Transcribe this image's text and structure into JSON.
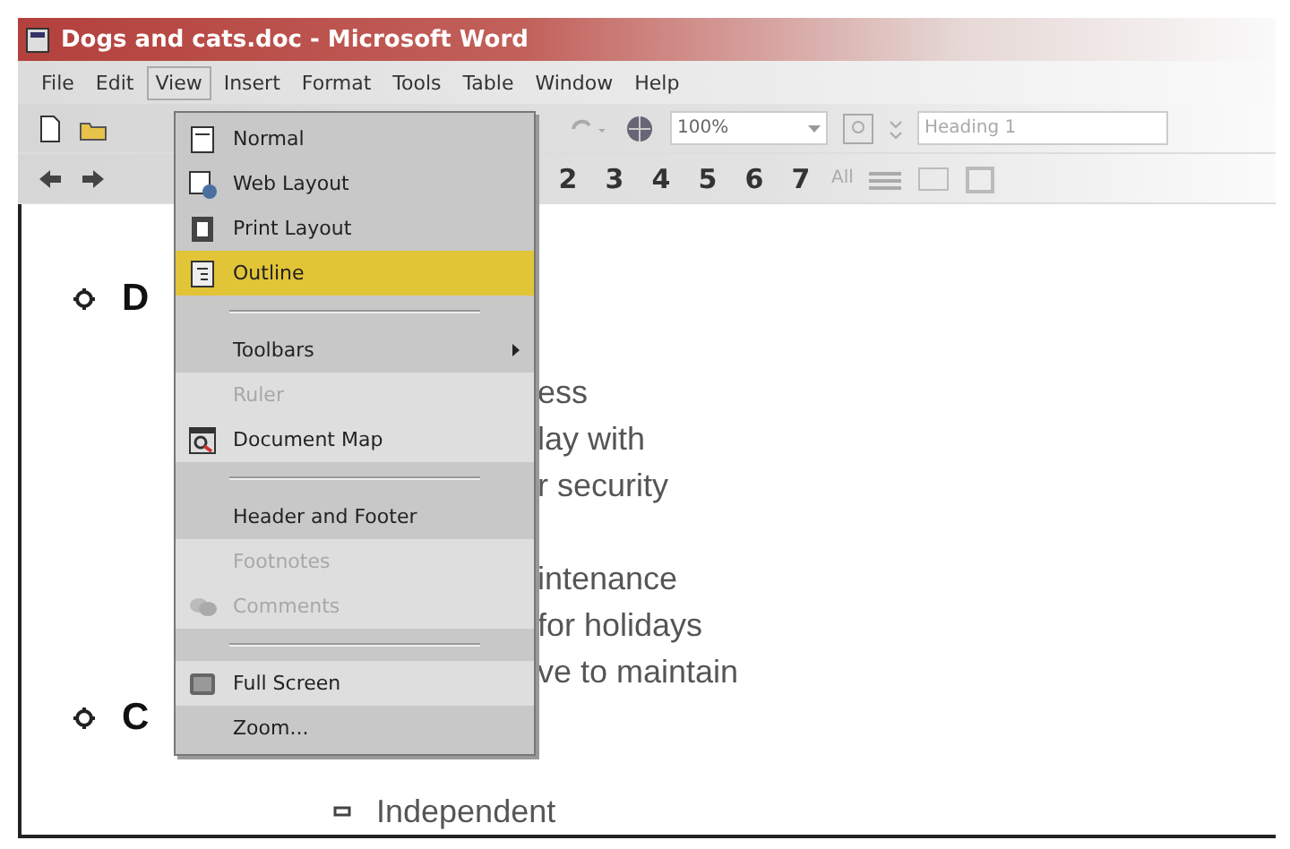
{
  "window": {
    "title": "Dogs and cats.doc - Microsoft Word"
  },
  "menu_bar": [
    {
      "label": "File",
      "selected": false
    },
    {
      "label": "Edit",
      "selected": false
    },
    {
      "label": "View",
      "selected": true
    },
    {
      "label": "Insert",
      "selected": false
    },
    {
      "label": "Format",
      "selected": false
    },
    {
      "label": "Tools",
      "selected": false
    },
    {
      "label": "Table",
      "selected": false
    },
    {
      "label": "Window",
      "selected": false
    },
    {
      "label": "Help",
      "selected": false
    }
  ],
  "standard_toolbar": {
    "zoom": "100%",
    "style": "Heading 1"
  },
  "outline_toolbar": {
    "levels": [
      "2",
      "3",
      "4",
      "5",
      "6",
      "7"
    ],
    "all": "All"
  },
  "view_menu": [
    {
      "kind": "item",
      "label": "Normal",
      "selected": false,
      "disabled": false,
      "rarely_used": false
    },
    {
      "kind": "item",
      "label": "Web Layout",
      "selected": false,
      "disabled": false,
      "rarely_used": false
    },
    {
      "kind": "item",
      "label": "Print Layout",
      "selected": false,
      "disabled": false,
      "rarely_used": false
    },
    {
      "kind": "item",
      "label": "Outline",
      "selected": true,
      "disabled": false,
      "rarely_used": false
    },
    {
      "kind": "separator"
    },
    {
      "kind": "submenu",
      "label": "Toolbars",
      "selected": false,
      "disabled": false,
      "rarely_used": false
    },
    {
      "kind": "item",
      "label": "Ruler",
      "selected": false,
      "disabled": true,
      "rarely_used": true
    },
    {
      "kind": "item",
      "label": "Document Map",
      "selected": false,
      "disabled": false,
      "rarely_used": true
    },
    {
      "kind": "separator"
    },
    {
      "kind": "item",
      "label": "Header and Footer",
      "selected": false,
      "disabled": false,
      "rarely_used": false
    },
    {
      "kind": "item",
      "label": "Footnotes",
      "selected": false,
      "disabled": true,
      "rarely_used": true
    },
    {
      "kind": "item",
      "label": "Comments",
      "selected": false,
      "disabled": true,
      "rarely_used": true
    },
    {
      "kind": "separator"
    },
    {
      "kind": "item",
      "label": "Full Screen",
      "selected": false,
      "disabled": false,
      "rarely_used": true
    },
    {
      "kind": "item",
      "label": "Zoom...",
      "selected": false,
      "disabled": false,
      "rarely_used": false
    }
  ],
  "document": [
    {
      "kind": "heading",
      "text": "D"
    },
    {
      "kind": "blank"
    },
    {
      "kind": "text",
      "text": "ess"
    },
    {
      "kind": "text",
      "text": "lay with"
    },
    {
      "kind": "text",
      "text": "r security"
    },
    {
      "kind": "blank"
    },
    {
      "kind": "text",
      "text": "intenance"
    },
    {
      "kind": "text",
      "text": "for holidays"
    },
    {
      "kind": "text",
      "text": "ve to maintain"
    },
    {
      "kind": "heading",
      "text": "C"
    },
    {
      "kind": "blank"
    },
    {
      "kind": "bullet",
      "text": "Independent"
    }
  ]
}
